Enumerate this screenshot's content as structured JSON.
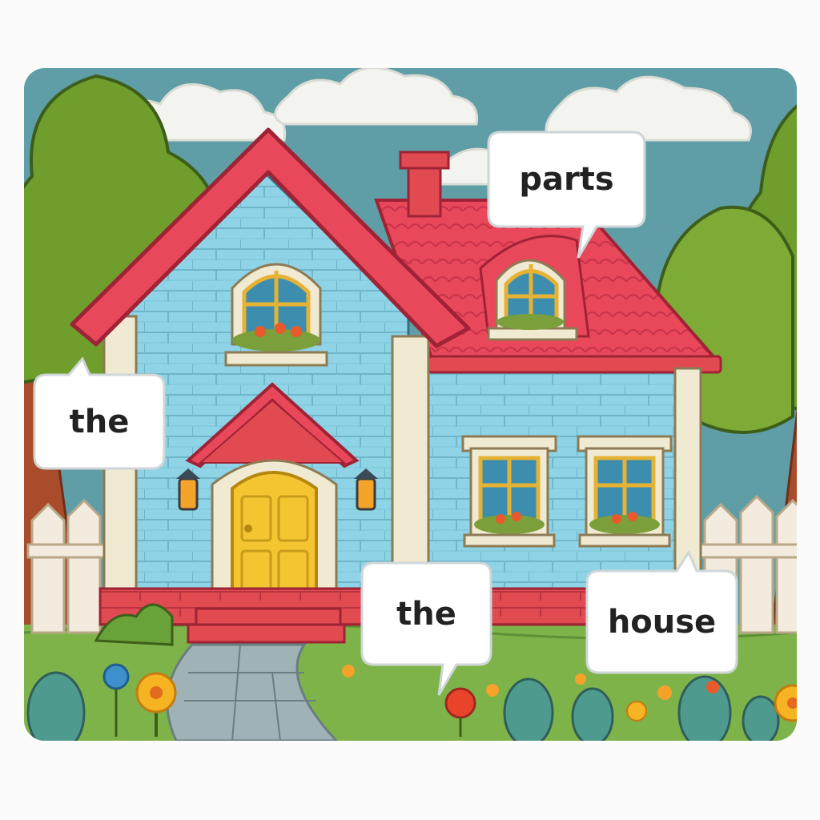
{
  "speech_bubbles": {
    "parts": "parts",
    "the_left": "the",
    "the_bottom": "the",
    "house": "house"
  },
  "colors": {
    "sky": "#5f9ea6",
    "cloud": "#f3f4ef",
    "grass": "#7eb34a",
    "tree_foliage": "#6f9e2c",
    "trunk": "#a84c2b",
    "house_wall": "#8fd3e6",
    "roof": "#e8485a",
    "trim": "#f1ead2",
    "door": "#f4c431",
    "window_frame": "#e6b233",
    "window_glass": "#3c8dae",
    "path": "#9fb3b6",
    "fence": "#f2ebde",
    "bubble": "#ffffff",
    "bubble_text": "#222222"
  },
  "icons": [
    "cloud-icon",
    "tree-icon",
    "flower-icon",
    "wall-lamp-icon",
    "chimney-icon",
    "fence-icon"
  ]
}
